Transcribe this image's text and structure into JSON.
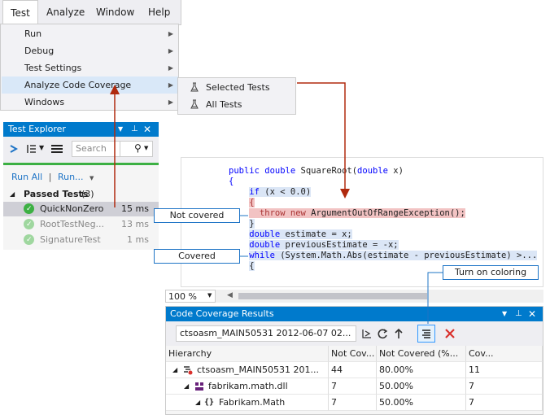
{
  "menu": {
    "items": [
      "Test",
      "Analyze",
      "Window",
      "Help"
    ],
    "dropdown": [
      "Run",
      "Debug",
      "Test Settings",
      "Analyze Code Coverage",
      "Windows"
    ],
    "submenu": [
      "Selected Tests",
      "All Tests"
    ]
  },
  "test_explorer": {
    "title": "Test Explorer",
    "search_placeholder": "Search",
    "run_all": "Run All",
    "run_sep": "|",
    "run_more": "Run...",
    "group_label": "Passed Tests",
    "group_count": "(3)",
    "tests": [
      {
        "name": "QuickNonZero",
        "time": "15 ms"
      },
      {
        "name": "RootTestNeg...",
        "time": "13 ms"
      },
      {
        "name": "SignatureTest",
        "time": "1 ms"
      }
    ]
  },
  "callouts": {
    "not_covered": "Not covered",
    "covered": "Covered",
    "turn_on_coloring": "Turn on coloring"
  },
  "code": {
    "lines": [
      "public double SquareRoot(double x)",
      "{",
      "    if (x < 0.0)",
      "    {",
      "      throw new ArgumentOutOfRangeException();",
      "    }",
      "    double estimate = x;",
      "    double previousEstimate = -x;",
      "    while (System.Math.Abs(estimate - previousEstimate) >...",
      "    {"
    ]
  },
  "zoom": "100 %",
  "coverage": {
    "title": "Code Coverage Results",
    "run_selector": "ctsoasm_MAIN50531 2012-06-07 02...",
    "columns": [
      "Hierarchy",
      "Not Cov...",
      "Not Covered (%...",
      "Cov..."
    ],
    "rows": [
      {
        "name": "ctsoasm_MAIN50531 201...",
        "not_cov": "44",
        "not_cov_pct": "80.00%",
        "cov": "11"
      },
      {
        "name": "fabrikam.math.dll",
        "not_cov": "7",
        "not_cov_pct": "50.00%",
        "cov": "7"
      },
      {
        "name": "Fabrikam.Math",
        "not_cov": "7",
        "not_cov_pct": "50.00%",
        "cov": "7"
      }
    ]
  },
  "colors": {
    "accent": "#007acc",
    "pass": "#3cb043",
    "arrow": "#b02a0e",
    "covered_bg": "#dbe6f6",
    "not_covered_bg": "#f2c3c3"
  }
}
